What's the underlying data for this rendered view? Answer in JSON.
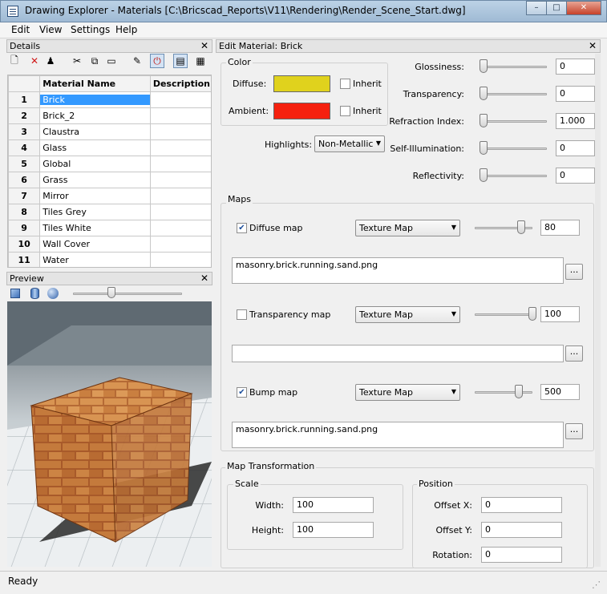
{
  "window": {
    "title": "Drawing Explorer - Materials [C:\\Bricscad_Reports\\V11\\Rendering\\Render_Scene_Start.dwg]",
    "min_glyph": "–",
    "max_glyph": "□",
    "close_glyph": "✕"
  },
  "menu": [
    "Edit",
    "View",
    "Settings",
    "Help"
  ],
  "details": {
    "header": "Details",
    "close": "✕",
    "toolbar_icons": [
      "new-icon",
      "delete-icon",
      "purge-icon",
      "cut-icon",
      "copy-icon",
      "paste-icon",
      "edit-icon",
      "power-icon",
      "list-view-icon",
      "grid-view-icon"
    ],
    "toolbar_glyphs": [
      "🗋",
      "✕",
      "♟",
      "✂",
      "⧉",
      "▭",
      "✎",
      "⏻",
      "▤",
      "▦"
    ],
    "columns": [
      "Material Name",
      "Description"
    ],
    "rows": [
      {
        "n": "1",
        "name": "Brick",
        "desc": ""
      },
      {
        "n": "2",
        "name": "Brick_2",
        "desc": ""
      },
      {
        "n": "3",
        "name": "Claustra",
        "desc": ""
      },
      {
        "n": "4",
        "name": "Glass",
        "desc": ""
      },
      {
        "n": "5",
        "name": "Global",
        "desc": ""
      },
      {
        "n": "6",
        "name": "Grass",
        "desc": ""
      },
      {
        "n": "7",
        "name": "Mirror",
        "desc": ""
      },
      {
        "n": "8",
        "name": "Tiles Grey",
        "desc": ""
      },
      {
        "n": "9",
        "name": "Tiles White",
        "desc": ""
      },
      {
        "n": "10",
        "name": "Wall Cover",
        "desc": ""
      },
      {
        "n": "11",
        "name": "Water",
        "desc": ""
      }
    ],
    "selected_row": 0
  },
  "preview": {
    "header": "Preview",
    "close": "✕",
    "shape_icons": [
      "cube-icon",
      "cylinder-icon",
      "sphere-icon"
    ],
    "zoom_level": 0.35
  },
  "edit": {
    "header": "Edit Material: Brick",
    "close": "✕",
    "color": {
      "group_label": "Color",
      "diffuse_label": "Diffuse:",
      "diffuse_color": "#e0d21d",
      "ambient_label": "Ambient:",
      "ambient_color": "#f5210f",
      "inherit_label": "Inherit",
      "inherit_check": ""
    },
    "highlights": {
      "label": "Highlights:",
      "value": "Non-Metallic",
      "arrow": "▼"
    },
    "props": [
      {
        "label": "Glossiness:",
        "value": "0",
        "level": 0
      },
      {
        "label": "Transparency:",
        "value": "0",
        "level": 0
      },
      {
        "label": "Refraction Index:",
        "value": "1.000",
        "level": 0
      },
      {
        "label": "Self-Illumination:",
        "value": "0",
        "level": 0
      },
      {
        "label": "Reflectivity:",
        "value": "0",
        "level": 0
      }
    ],
    "maps": {
      "group_label": "Maps",
      "items": [
        {
          "label": "Diffuse map",
          "checked": "✔",
          "type": "Texture Map",
          "value": "80",
          "level": 0.8,
          "file": "masonry.brick.running.sand.png"
        },
        {
          "label": "Transparency map",
          "checked": "",
          "type": "Texture Map",
          "value": "100",
          "level": 1.0,
          "file": ""
        },
        {
          "label": "Bump map",
          "checked": "✔",
          "type": "Texture Map",
          "value": "500",
          "level": 0.77,
          "file": "masonry.brick.running.sand.png"
        }
      ],
      "browse": "...",
      "arrow": "▼"
    },
    "transform": {
      "group_label": "Map Transformation",
      "scale_label": "Scale",
      "width_label": "Width:",
      "width": "100",
      "height_label": "Height:",
      "height": "100",
      "position_label": "Position",
      "offset_x_label": "Offset X:",
      "offset_x": "0",
      "offset_y_label": "Offset Y:",
      "offset_y": "0",
      "rotation_label": "Rotation:",
      "rotation": "0"
    }
  },
  "status": {
    "text": "Ready",
    "grip": "⋰"
  }
}
